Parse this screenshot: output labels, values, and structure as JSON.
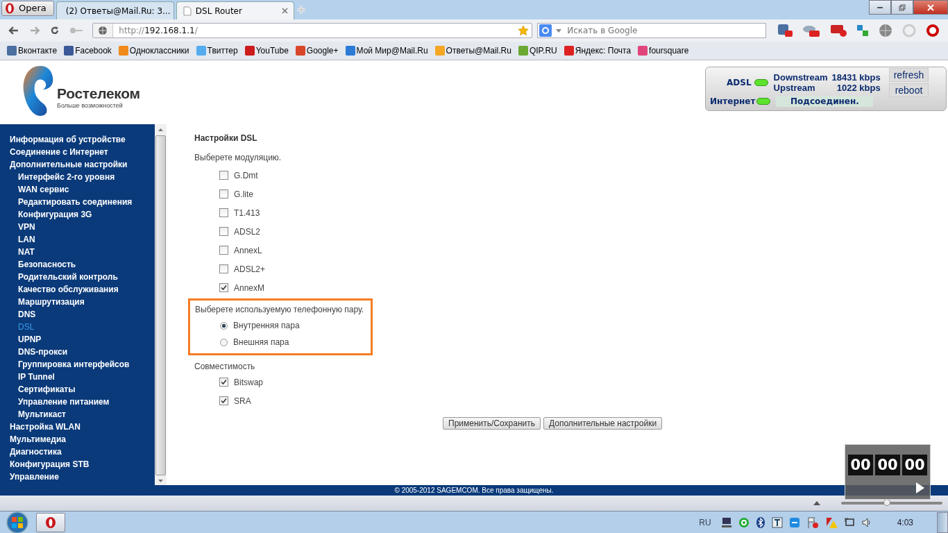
{
  "browser": {
    "menu_button": "Opera",
    "tabs": [
      {
        "label": "(2) Ответы@Mail.Ru: 3...",
        "selected": false
      },
      {
        "label": "DSL Router",
        "selected": true
      }
    ],
    "address": {
      "scheme": "http://",
      "host": "192.168.1.1",
      "path": "/"
    },
    "search": {
      "placeholder": "Искать в Google"
    },
    "bookmarks": [
      {
        "label": "Вконтакте",
        "color": "#4a6fa0"
      },
      {
        "label": "Facebook",
        "color": "#3b5998"
      },
      {
        "label": "Одноклассники",
        "color": "#f08a1c"
      },
      {
        "label": "Твиттер",
        "color": "#55acee"
      },
      {
        "label": "YouTube",
        "color": "#cc1c1c"
      },
      {
        "label": "Google+",
        "color": "#d9472b"
      },
      {
        "label": "Мой Мир@Mail.Ru",
        "color": "#2a7ad6"
      },
      {
        "label": "Ответы@Mail.Ru",
        "color": "#f5a623"
      },
      {
        "label": "QIP.RU",
        "color": "#6aa832"
      },
      {
        "label": "Яндекс: Почта",
        "color": "#dd2222"
      },
      {
        "label": "foursquare",
        "color": "#e0457b"
      }
    ]
  },
  "router": {
    "logo_name": "Ростелеком",
    "logo_slogan": "Больше возможностей",
    "status": {
      "adsl_label": "ADSL",
      "adsl_on": true,
      "downstream_label": "Downstream",
      "downstream": "18431 kbps",
      "upstream_label": "Upstream",
      "upstream": "1022 kbps",
      "internet_label": "Интернет",
      "internet_on": true,
      "connection": "Подсоединен.",
      "buttons": [
        "refresh",
        "reboot"
      ]
    }
  },
  "sidebar": {
    "items": [
      {
        "label": "Информация об устройстве",
        "selected": false
      },
      {
        "label": "Соединение с Интернет",
        "selected": false
      },
      {
        "label": "Дополнительные настройки",
        "selected": false,
        "children": [
          {
            "label": "Интерфейс 2-го уровня",
            "selected": false
          },
          {
            "label": "WAN сервис",
            "selected": false
          },
          {
            "label": "Редактировать соединения",
            "selected": false
          },
          {
            "label": "Конфигурация 3G",
            "selected": false
          },
          {
            "label": "VPN",
            "selected": false
          },
          {
            "label": "LAN",
            "selected": false
          },
          {
            "label": "NAT",
            "selected": false
          },
          {
            "label": "Безопасность",
            "selected": false
          },
          {
            "label": "Родительский контроль",
            "selected": false
          },
          {
            "label": "Качество обслуживания",
            "selected": false
          },
          {
            "label": "Маршрутизация",
            "selected": false
          },
          {
            "label": "DNS",
            "selected": false
          },
          {
            "label": "DSL",
            "selected": true
          },
          {
            "label": "UPNP",
            "selected": false
          },
          {
            "label": "DNS-прокси",
            "selected": false
          },
          {
            "label": "Группировка интерфейсов",
            "selected": false
          },
          {
            "label": "IP Tunnel",
            "selected": false
          },
          {
            "label": "Сертификаты",
            "selected": false
          },
          {
            "label": "Управление питанием",
            "selected": false
          },
          {
            "label": "Мультикаст",
            "selected": false
          }
        ]
      },
      {
        "label": "Настройка WLAN",
        "selected": false
      },
      {
        "label": "Мультимедиа",
        "selected": false
      },
      {
        "label": "Диагностика",
        "selected": false
      },
      {
        "label": "Конфигурация STB",
        "selected": false
      },
      {
        "label": "Управление",
        "selected": false
      }
    ]
  },
  "content": {
    "title": "Настройки DSL",
    "modulation_label": "Выберете модуляцию.",
    "modulations": [
      {
        "label": "G.Dmt",
        "checked": false
      },
      {
        "label": "G.lite",
        "checked": false
      },
      {
        "label": "T1.413",
        "checked": false
      },
      {
        "label": "ADSL2",
        "checked": false
      },
      {
        "label": "AnnexL",
        "checked": false
      },
      {
        "label": "ADSL2+",
        "checked": false
      },
      {
        "label": "AnnexM",
        "checked": true
      }
    ],
    "pair_label": "Выберете используемую телефонную пару.",
    "pairs": [
      {
        "label": "Внутренняя пара",
        "selected": true
      },
      {
        "label": "Внешняя пара",
        "selected": false
      }
    ],
    "compat_label": "Совместимость",
    "compat": [
      {
        "label": "Bitswap",
        "checked": true
      },
      {
        "label": "SRA",
        "checked": true
      }
    ],
    "buttons": [
      "Применить/Сохранить",
      "Дополнительные настройки"
    ]
  },
  "footer": "© 2005-2012 SAGEMCOM. Все права защищены.",
  "timer": [
    "00",
    "00",
    "00"
  ],
  "zoom": {
    "level": 0.45
  },
  "taskbar": {
    "language": "RU",
    "clock": "4:03"
  }
}
